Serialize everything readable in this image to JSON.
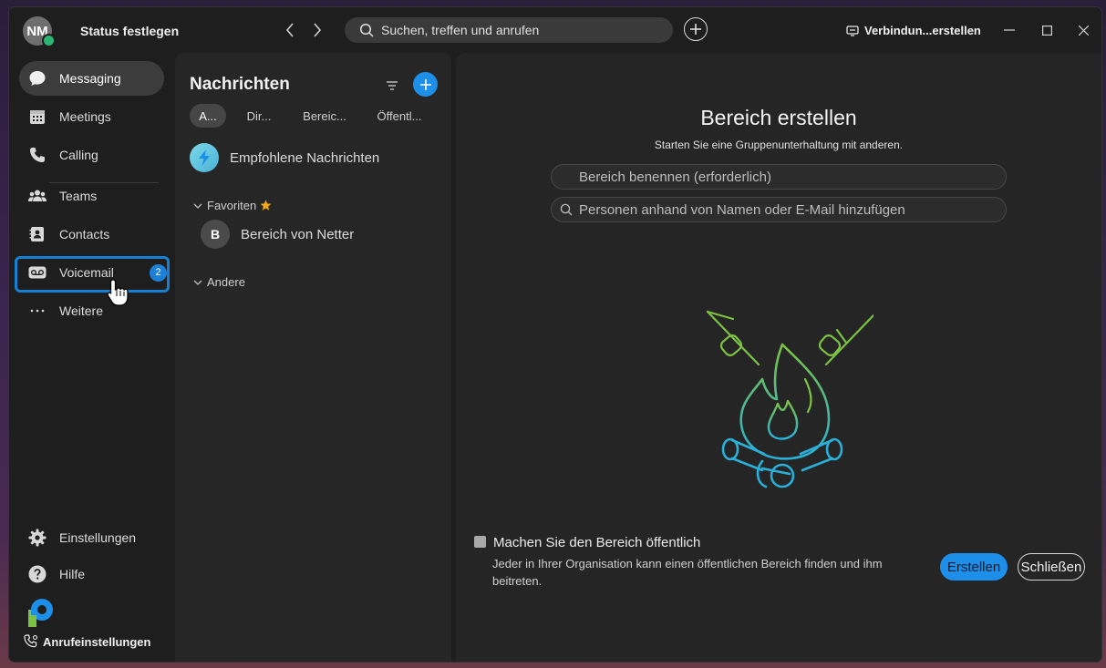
{
  "titlebar": {
    "avatar_initials": "NM",
    "status_label": "Status festlegen",
    "search_placeholder": "Suchen, treffen und anrufen",
    "connect_label": "Verbindun...erstellen"
  },
  "sidebar": {
    "items": [
      {
        "label": "Messaging",
        "icon": "chat-icon"
      },
      {
        "label": "Meetings",
        "icon": "calendar-icon"
      },
      {
        "label": "Calling",
        "icon": "phone-icon"
      },
      {
        "label": "Teams",
        "icon": "people-icon"
      },
      {
        "label": "Contacts",
        "icon": "contacts-icon"
      },
      {
        "label": "Voicemail",
        "icon": "voicemail-icon",
        "badge": "2"
      },
      {
        "label": "Weitere",
        "icon": "more-icon"
      }
    ],
    "bottom": {
      "settings_label": "Einstellungen",
      "help_label": "Hilfe",
      "call_settings_label": "Anrufeinstellungen"
    }
  },
  "messages": {
    "title": "Nachrichten",
    "tabs": [
      "A...",
      "Dir...",
      "Bereic...",
      "Öffentl..."
    ],
    "recommended_label": "Empfohlene Nachrichten",
    "favorites_label": "Favoriten",
    "favorite_space": {
      "initial": "B",
      "label": "Bereich von Netter"
    },
    "other_label": "Andere"
  },
  "create_space": {
    "title": "Bereich erstellen",
    "subtitle": "Starten Sie eine Gruppenunterhaltung mit anderen.",
    "name_placeholder": "Bereich benennen (erforderlich)",
    "people_placeholder": "Personen anhand von Namen oder E-Mail hinzufügen",
    "public_label": "Machen Sie den Bereich öffentlich",
    "public_description": "Jeder in Ihrer Organisation kann einen öffentlichen Bereich finden und ihm beitreten.",
    "create_button": "Erstellen",
    "close_button": "Schließen"
  },
  "colors": {
    "accent": "#1d8fe8",
    "focus_ring": "#1780d4",
    "presence": "#2bb673"
  }
}
